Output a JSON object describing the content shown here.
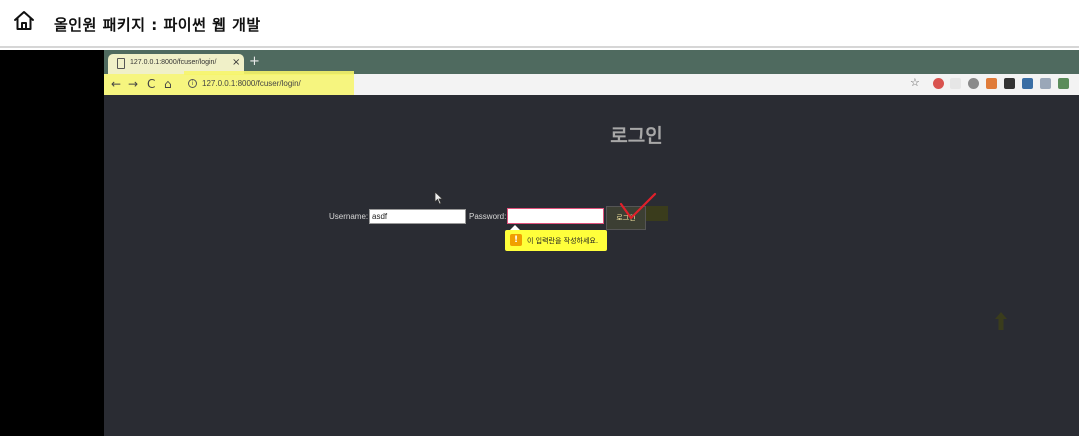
{
  "header": {
    "title": "올인원 패키지 : 파이썬 웹 개발",
    "home_icon": "home-icon"
  },
  "browser": {
    "tab": {
      "title": "127.0.0.1:8000/fcuser/login/",
      "close": "×"
    },
    "new_tab": "+",
    "nav": {
      "back": "←",
      "forward": "→",
      "reload": "C",
      "home": "⌂"
    },
    "url": "127.0.0.1:8000/fcuser/login/",
    "bookmark_icon": "star-icon",
    "highlight_color": "#f6f56a"
  },
  "page": {
    "heading": "로그인",
    "username_label": "Username:",
    "username_value": "asdf",
    "password_label": "Password:",
    "password_value": "",
    "submit_label": "로그인",
    "validation_message": "이 입력란을 작성하세요.",
    "warning_icon": "!"
  },
  "colors": {
    "page_background": "#2a2c33",
    "tab_bar": "#4f6a5f",
    "tooltip": "#ffff3b",
    "annotation": "#e0202a"
  }
}
